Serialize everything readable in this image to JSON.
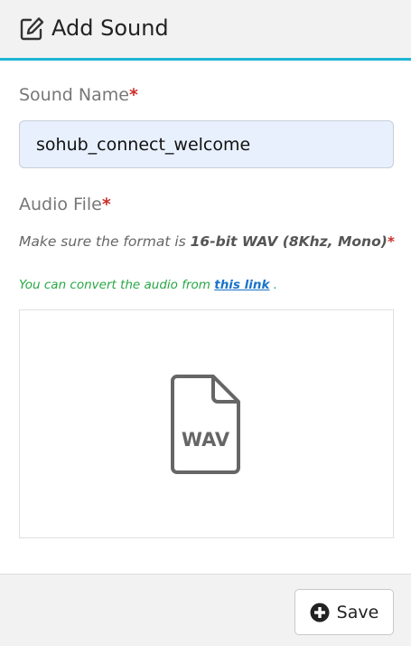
{
  "header": {
    "title": "Add Sound",
    "icon": "edit-icon"
  },
  "form": {
    "sound_name": {
      "label": "Sound Name",
      "required_mark": "*",
      "value": "sohub_connect_welcome"
    },
    "audio_file": {
      "label": "Audio File",
      "required_mark": "*",
      "format_prefix": "Make sure the format is ",
      "format_value": "16-bit WAV (8Khz, Mono)",
      "format_required_mark": "*",
      "convert_prefix": "You can convert the audio from ",
      "convert_link": "this link",
      "convert_suffix": " .",
      "file_type_label": "WAV",
      "file_icon": "wav-file-icon"
    }
  },
  "footer": {
    "save_label": "Save",
    "save_icon": "plus-circle-icon"
  },
  "colors": {
    "accent": "#1fb6d6",
    "required": "#c9302c",
    "success_text": "#28a745",
    "link": "#1a73c9",
    "input_bg": "#e8f0fe"
  }
}
